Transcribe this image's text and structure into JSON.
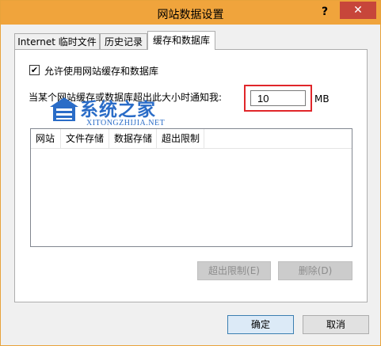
{
  "window": {
    "title": "网站数据设置",
    "help_label": "?",
    "close_label": "✕"
  },
  "tabs": [
    {
      "label": "Internet 临时文件",
      "active": false
    },
    {
      "label": "历史记录",
      "active": false
    },
    {
      "label": "缓存和数据库",
      "active": true
    }
  ],
  "cache": {
    "allow_checkbox_label": "允许使用网站缓存和数据库",
    "allow_checked": true,
    "notify_label": "当某个网站缓存或数据库超出此大小时通知我:",
    "size_value": "10",
    "size_unit": "MB"
  },
  "table": {
    "columns": [
      "网站",
      "文件存储",
      "数据存储",
      "超出限制"
    ],
    "rows": []
  },
  "buttons": {
    "exceed_limit": "超出限制(E)",
    "delete": "删除(D)",
    "ok": "确定",
    "cancel": "取消"
  },
  "watermark": {
    "text": "系统之家",
    "sub": "XITONGZHIJIA.NET"
  },
  "colors": {
    "title_bar": "#f0a43c",
    "close_button": "#c7463a",
    "highlight_box": "#e0262a",
    "watermark": "#2a6cc7"
  }
}
